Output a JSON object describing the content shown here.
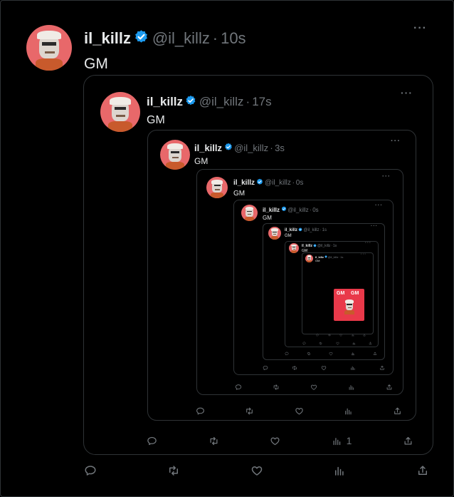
{
  "user": {
    "name": "il_killz",
    "handle": "@il_killz"
  },
  "tweets": [
    {
      "time": "10s",
      "text": "GM",
      "replies": "",
      "retweets": "",
      "likes": "",
      "views": ""
    },
    {
      "time": "17s",
      "text": "GM",
      "views": "1"
    },
    {
      "time": "3s",
      "text": "GM"
    },
    {
      "time": "0s",
      "text": "GM"
    },
    {
      "time": "0s",
      "text": "GM"
    },
    {
      "time": "1s",
      "text": "GM"
    },
    {
      "time": "1s",
      "text": "GM"
    },
    {
      "time": "1s",
      "text": "GM"
    }
  ],
  "inner_image_text": "GM",
  "more_glyph": "···",
  "separator": "·",
  "icons": {
    "verified": "verified-badge-icon",
    "reply": "reply-icon",
    "retweet": "retweet-icon",
    "like": "like-icon",
    "views": "views-icon",
    "share": "share-icon",
    "more": "more-icon"
  },
  "colors": {
    "background": "#000000",
    "text": "#e7e9ea",
    "muted": "#71767b",
    "border": "#2f3336",
    "verified": "#1d9bf0",
    "avatar": "#e8686a",
    "card": "#e9394a"
  }
}
